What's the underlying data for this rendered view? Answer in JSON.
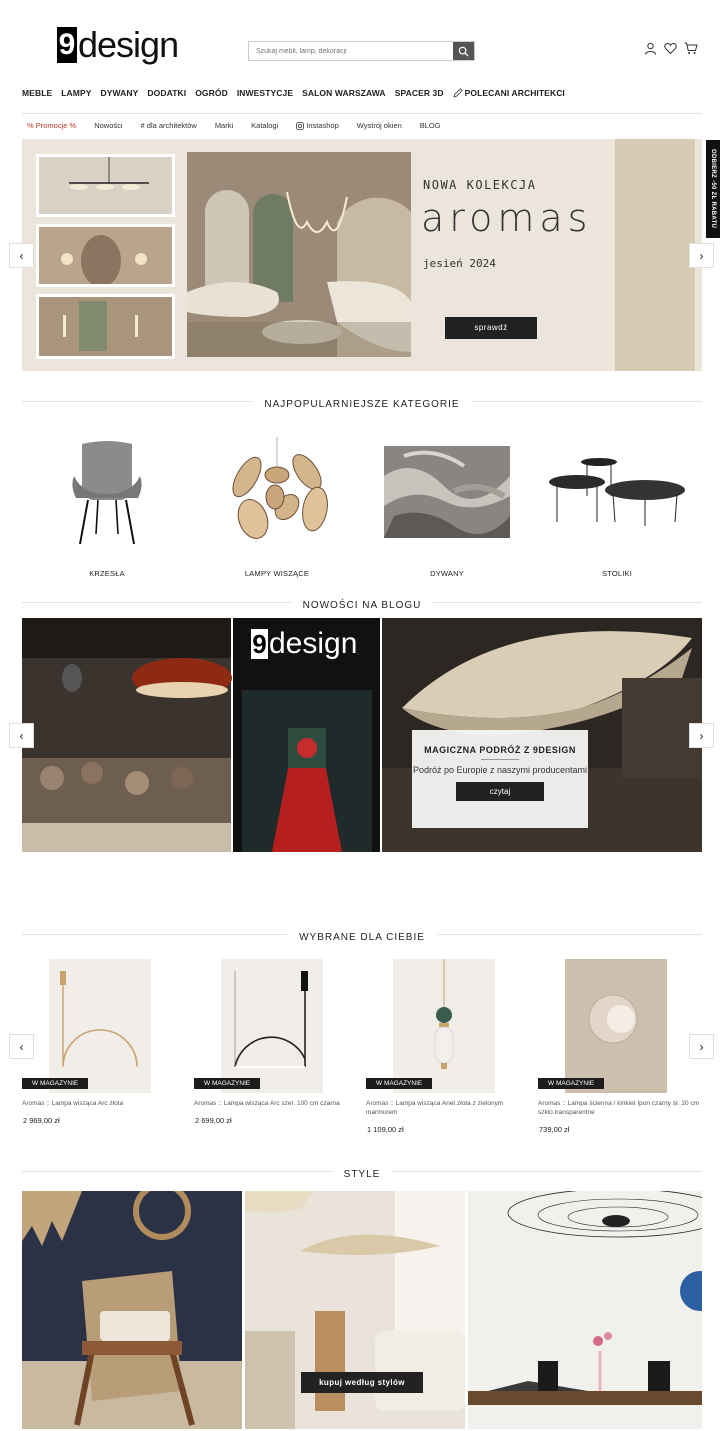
{
  "header": {
    "logo_mark": "9",
    "logo_text": "design",
    "search_placeholder": "Szukaj mebli, lamp, dekoracji"
  },
  "main_nav": [
    "MEBLE",
    "LAMPY",
    "DYWANY",
    "DODATKI",
    "OGRÓD",
    "INWESTYCJE",
    "SALON WARSZAWA",
    "SPACER 3D",
    "POLECANI ARCHITEKCI"
  ],
  "sub_nav": [
    "% Promocje %",
    "Nowości",
    "# dla architektów",
    "Marki",
    "Katalogi",
    "Instashop",
    "Wystrój okien",
    "BLOG"
  ],
  "side_tab": "ODBIERZ -50 ZŁ RABATU",
  "hero": {
    "title": "NOWA KOLEKCJA",
    "script": "aromas",
    "subtitle": "jesień 2024",
    "button": "sprawdź"
  },
  "categories": {
    "title": "NAJPOPULARNIEJSZE KATEGORIE",
    "items": [
      "KRZESŁA",
      "LAMPY WISZĄCE",
      "DYWANY",
      "STOLIKI"
    ]
  },
  "blog": {
    "title": "NOWOŚCI NA BLOGU",
    "logo_mark": "9",
    "logo_text": "design",
    "card_title": "MAGICZNA PODRÓŻ Z 9DESIGN",
    "card_text": "Podróż po Europie z naszymi producentami",
    "card_button": "czytaj"
  },
  "products": {
    "title": "WYBRANE DLA CIEBIE",
    "items": [
      {
        "badge": "W MAGAZYNIE",
        "name": "Aromas :: Lampa wisząca Arc złota",
        "price": "2 969,00 zł"
      },
      {
        "badge": "W MAGAZYNIE",
        "name": "Aromas :: Lampa wisząca Arc szer. 100 cm czarna",
        "price": "2 699,00 zł"
      },
      {
        "badge": "W MAGAZYNIE",
        "name": "Aromas :: Lampa wisząca Anet złota z zielonym marmurem",
        "price": "1 109,00 zł"
      },
      {
        "badge": "W MAGAZYNIE",
        "name": "Aromas :: Lampa ścienna / kinkiet Ipon czarny śr. 20 cm szkło transparentne",
        "price": "739,00 zł"
      }
    ]
  },
  "styles": {
    "title": "STYLE",
    "button": "kupuj według stylów"
  },
  "arrows": {
    "prev": "‹",
    "next": "›"
  }
}
